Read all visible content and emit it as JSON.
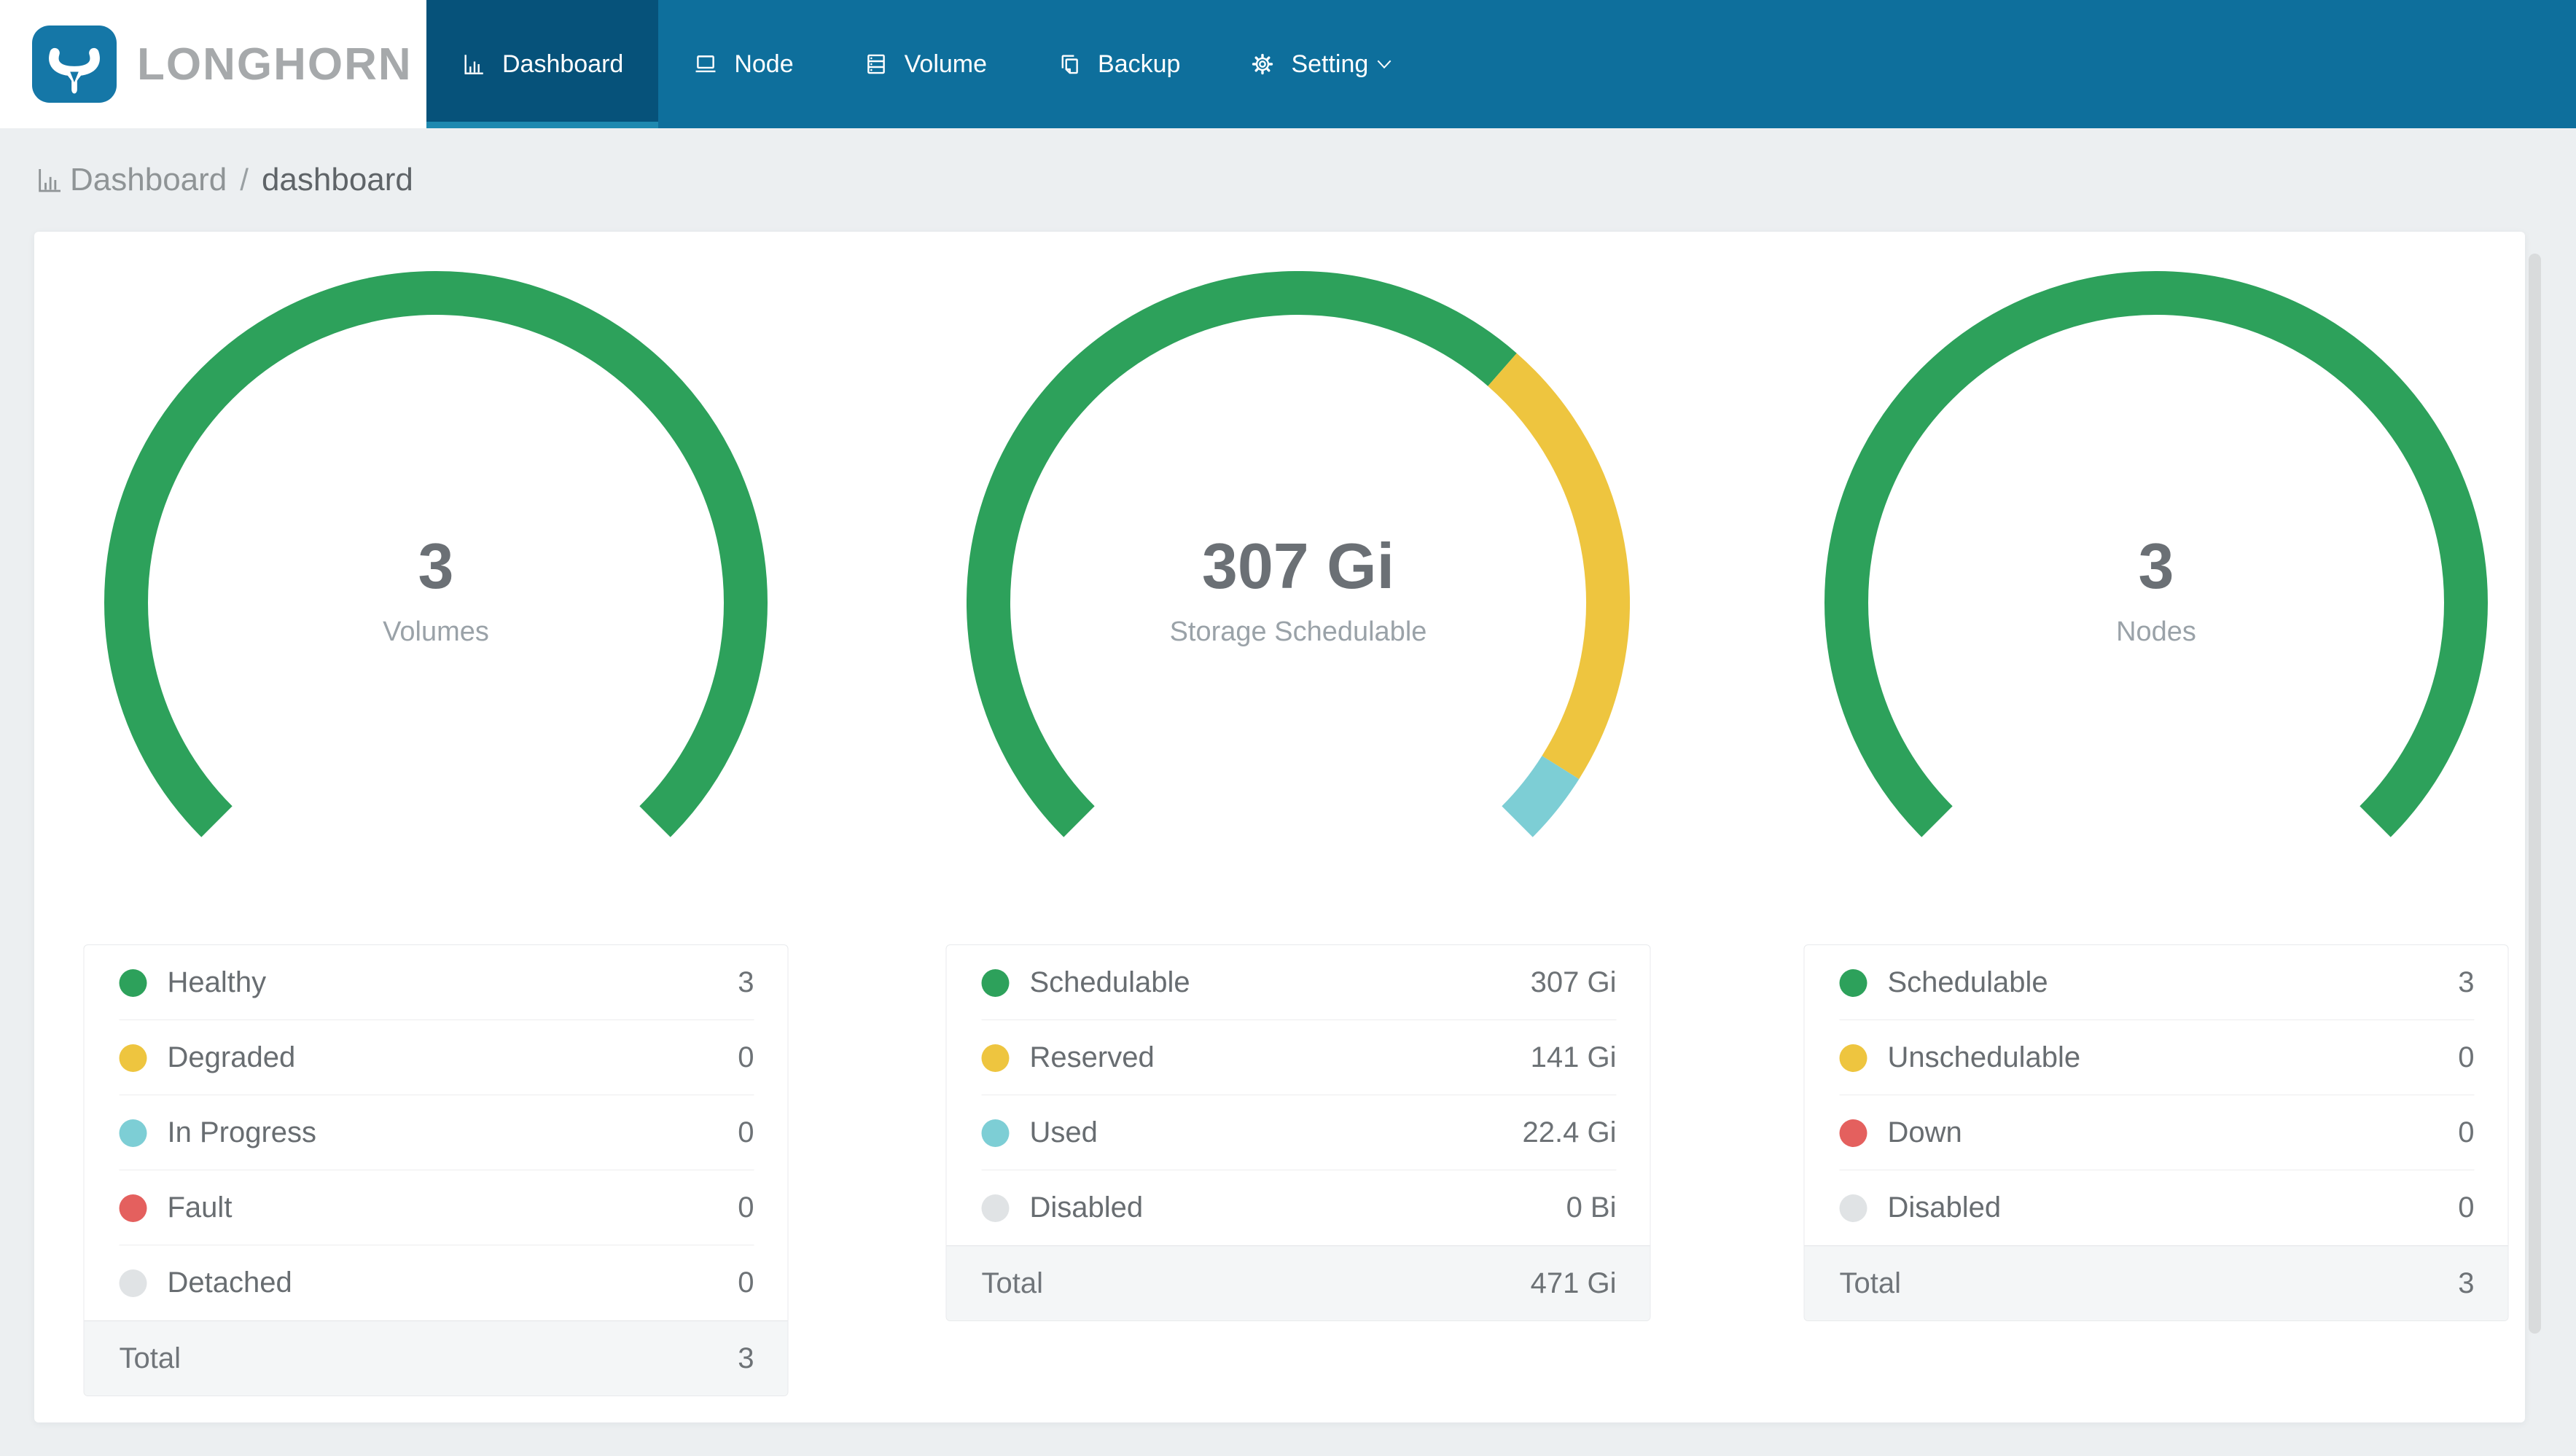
{
  "brand": {
    "name": "LONGHORN",
    "logo_icon": "longhorn-bull-icon",
    "logo_bg": "#1577a7",
    "text_color": "#a6a9ab"
  },
  "nav": {
    "bg": "#0e6f9c",
    "active_bg": "#06527a",
    "active_underline": "#1e89b0",
    "items": [
      {
        "label": "Dashboard",
        "icon": "bar-chart-icon",
        "active": true
      },
      {
        "label": "Node",
        "icon": "laptop-icon",
        "active": false
      },
      {
        "label": "Volume",
        "icon": "database-icon",
        "active": false
      },
      {
        "label": "Backup",
        "icon": "copy-icon",
        "active": false
      },
      {
        "label": "Setting",
        "icon": "gear-icon",
        "active": false,
        "has_caret": true
      }
    ]
  },
  "breadcrumb": {
    "icon": "bar-chart-icon",
    "section": "Dashboard",
    "separator": "/",
    "page": "dashboard"
  },
  "chart_data": [
    {
      "type": "gauge",
      "title": "Volumes",
      "center_value": "3",
      "center_label": "Volumes",
      "start_deg": 225,
      "sweep_deg": 270,
      "segments": [
        {
          "label": "Healthy",
          "value": 3,
          "display": "3",
          "color": "#2da15b"
        },
        {
          "label": "Degraded",
          "value": 0,
          "display": "0",
          "color": "#eec53f"
        },
        {
          "label": "In Progress",
          "value": 0,
          "display": "0",
          "color": "#7dced5"
        },
        {
          "label": "Fault",
          "value": 0,
          "display": "0",
          "color": "#e4605e"
        },
        {
          "label": "Detached",
          "value": 0,
          "display": "0",
          "color": "#e0e3e5"
        }
      ],
      "total": {
        "label": "Total",
        "display": "3"
      }
    },
    {
      "type": "gauge",
      "title": "Storage Schedulable",
      "center_value": "307 Gi",
      "center_label": "Storage Schedulable",
      "start_deg": 225,
      "sweep_deg": 270,
      "segments": [
        {
          "label": "Schedulable",
          "value": 307,
          "display": "307 Gi",
          "color": "#2da15b"
        },
        {
          "label": "Reserved",
          "value": 141,
          "display": "141 Gi",
          "color": "#eec53f"
        },
        {
          "label": "Used",
          "value": 22.4,
          "display": "22.4 Gi",
          "color": "#7dced5"
        },
        {
          "label": "Disabled",
          "value": 0,
          "display": "0 Bi",
          "color": "#e0e3e5"
        }
      ],
      "total": {
        "label": "Total",
        "display": "471 Gi"
      }
    },
    {
      "type": "gauge",
      "title": "Nodes",
      "center_value": "3",
      "center_label": "Nodes",
      "start_deg": 225,
      "sweep_deg": 270,
      "segments": [
        {
          "label": "Schedulable",
          "value": 3,
          "display": "3",
          "color": "#2da15b"
        },
        {
          "label": "Unschedulable",
          "value": 0,
          "display": "0",
          "color": "#eec53f"
        },
        {
          "label": "Down",
          "value": 0,
          "display": "0",
          "color": "#e4605e"
        },
        {
          "label": "Disabled",
          "value": 0,
          "display": "0",
          "color": "#e0e3e5"
        }
      ],
      "total": {
        "label": "Total",
        "display": "3"
      }
    }
  ],
  "scrollbar": {
    "thumb_color": "#d9dbdc"
  }
}
